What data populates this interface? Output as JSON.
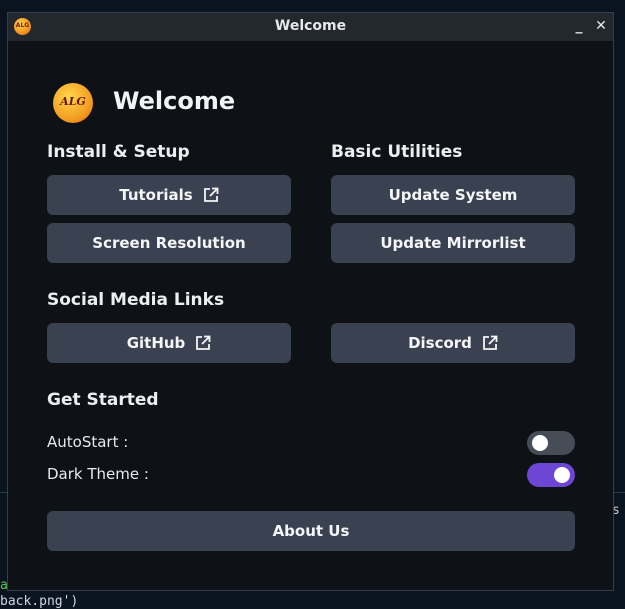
{
  "window": {
    "title": "Welcome",
    "logo_text": "ALG",
    "minimize_glyph": "_",
    "close_glyph": "✕"
  },
  "header": {
    "logo_text": "ALG",
    "heading": "Welcome"
  },
  "sections": {
    "install_setup": {
      "title": "Install & Setup",
      "tutorials_label": "Tutorials",
      "screen_resolution_label": "Screen Resolution"
    },
    "basic_utilities": {
      "title": "Basic Utilities",
      "update_system_label": "Update System",
      "update_mirrorlist_label": "Update Mirrorlist"
    },
    "social_media": {
      "title": "Social Media Links",
      "github_label": "GitHub",
      "discord_label": "Discord"
    },
    "get_started": {
      "title": "Get Started",
      "autostart_label": "AutoStart :",
      "autostart_on": false,
      "dark_theme_label": "Dark Theme :",
      "dark_theme_on": true
    }
  },
  "about_label": "About Us",
  "background_terminal": {
    "bottom_text": "back.png')",
    "left_fragment": "a",
    "right_fragment": "s"
  },
  "colors": {
    "window_bg": "#0e1115",
    "button_bg": "#3a4150",
    "toggle_on": "#6d46d6",
    "toggle_off": "#474d57"
  },
  "icons": [
    "external-link-icon",
    "alg-logo-icon",
    "minimize-icon",
    "close-icon"
  ]
}
